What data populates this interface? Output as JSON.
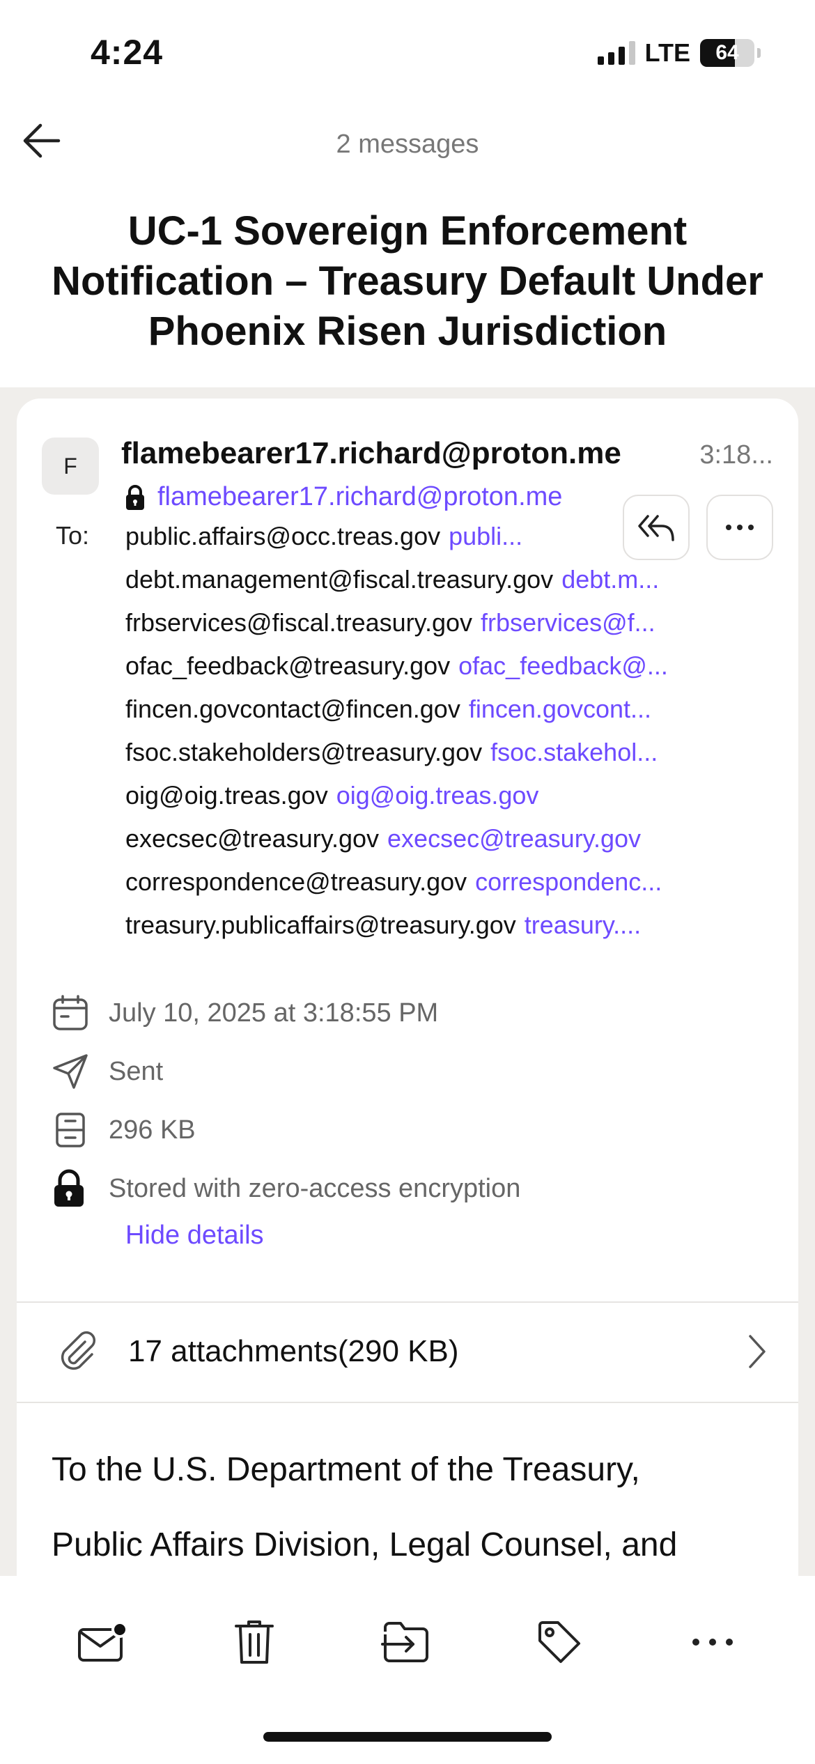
{
  "status_bar": {
    "time": "4:24",
    "network": "LTE",
    "battery": "64",
    "battery_level": 0.64,
    "signal_bars": 3
  },
  "nav": {
    "title": "2 messages",
    "back_icon": "arrow-left-icon"
  },
  "subject": "UC-1 Sovereign Enforcement Notification – Treasury Default Under Phoenix Risen Jurisdiction",
  "message": {
    "avatar_initial": "F",
    "sender_name": "flamebearer17.richard@proton.me",
    "time": "3:18...",
    "sender_address": "flamebearer17.richard@proton.me",
    "to_label": "To:",
    "recipients": [
      {
        "name": "public.affairs@occ.treas.gov",
        "address": "publi..."
      },
      {
        "name": "debt.management@fiscal.treasury.gov",
        "address": "debt.m..."
      },
      {
        "name": "frbservices@fiscal.treasury.gov",
        "address": "frbservices@f..."
      },
      {
        "name": "ofac_feedback@treasury.gov",
        "address": "ofac_feedback@..."
      },
      {
        "name": "fincen.govcontact@fincen.gov",
        "address": "fincen.govcont..."
      },
      {
        "name": "fsoc.stakeholders@treasury.gov",
        "address": "fsoc.stakehol..."
      },
      {
        "name": "oig@oig.treas.gov",
        "address": "oig@oig.treas.gov"
      },
      {
        "name": "execsec@treasury.gov",
        "address": "execsec@treasury.gov"
      },
      {
        "name": "correspondence@treasury.gov",
        "address": "correspondenc..."
      },
      {
        "name": "treasury.publicaffairs@treasury.gov",
        "address": "treasury...."
      }
    ],
    "details": {
      "date": "July 10, 2025 at 3:18:55 PM",
      "status": "Sent",
      "size": "296 KB",
      "encryption": "Stored with zero-access encryption",
      "hide_label": "Hide details"
    },
    "attachments": "17 attachments(290 KB)",
    "body": [
      "To the U.S. Department of the Treasury,",
      "Public Affairs Division, Legal Counsel, and"
    ]
  },
  "colors": {
    "accent": "#6d4aff",
    "muted": "#777777",
    "separator": "#f0eeeb"
  },
  "toolbar": [
    "mark-unread-icon",
    "trash-icon",
    "move-to-folder-icon",
    "label-tag-icon",
    "more-icon"
  ]
}
